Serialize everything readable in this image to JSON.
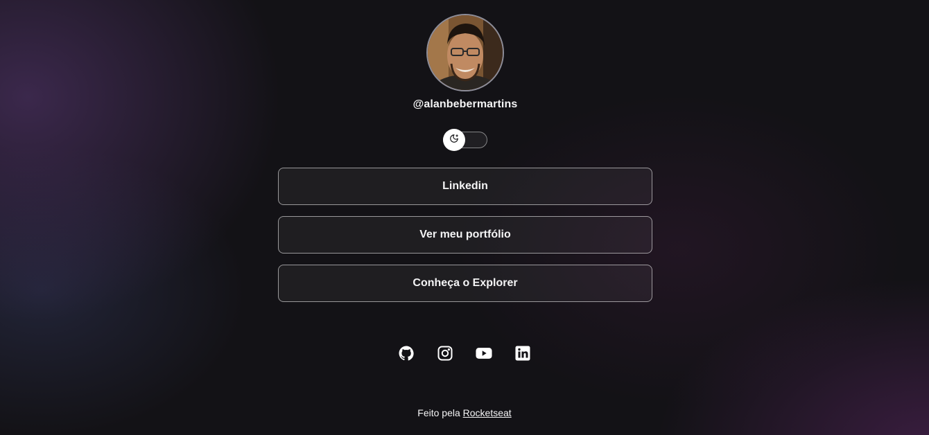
{
  "profile": {
    "username": "@alanbebermartins",
    "avatar_alt": "avatar"
  },
  "theme_switch": {
    "icon": "moon-icon",
    "state": "dark"
  },
  "links": [
    {
      "label": "Linkedin"
    },
    {
      "label": "Ver meu portfólio"
    },
    {
      "label": "Conheça o Explorer"
    }
  ],
  "socials": [
    {
      "icon": "github-icon"
    },
    {
      "icon": "instagram-icon"
    },
    {
      "icon": "youtube-icon"
    },
    {
      "icon": "linkedin-icon"
    }
  ],
  "footer": {
    "prefix": "Feito pela",
    "link_label": "Rocketseat"
  },
  "colors": {
    "background": "#131216",
    "text": "#f4f4f5",
    "border": "#8d8d99",
    "accent_purple": "#5c3a78"
  }
}
